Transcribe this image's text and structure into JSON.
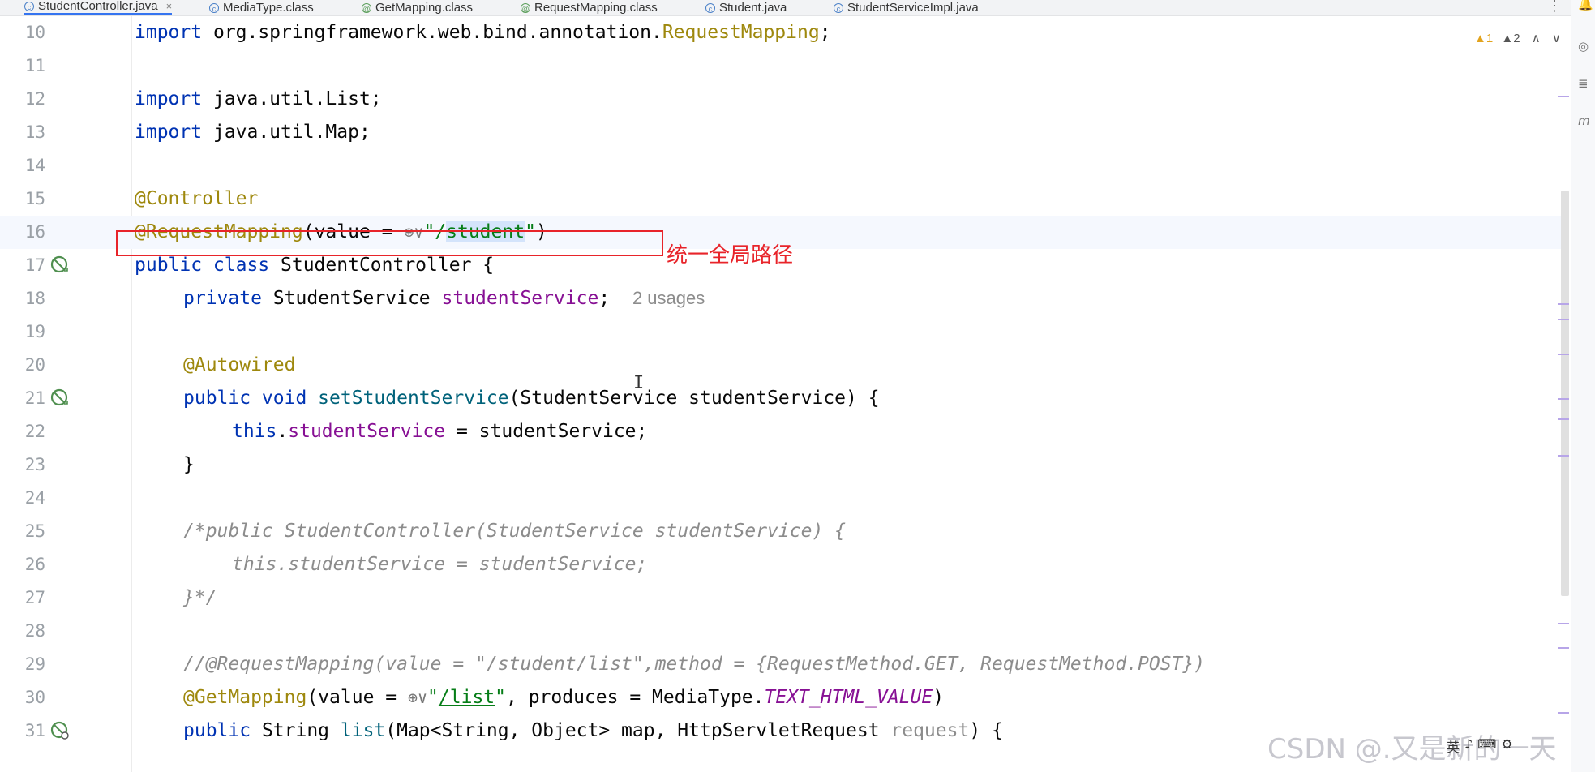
{
  "tabs": [
    {
      "label": "StudentController.java",
      "icon": "class-icon",
      "active": true
    },
    {
      "label": "MediaType.class",
      "icon": "class-icon"
    },
    {
      "label": "GetMapping.class",
      "icon": "annotation-icon"
    },
    {
      "label": "RequestMapping.class",
      "icon": "annotation-icon"
    },
    {
      "label": "Student.java",
      "icon": "class-icon"
    },
    {
      "label": "StudentServiceImpl.java",
      "icon": "class-icon"
    }
  ],
  "tab_close": "×",
  "tab_more": "⋮",
  "inspection": {
    "warnings": "▲1",
    "weak_warnings": "▲2",
    "up": "∧",
    "down": "∨"
  },
  "lines": {
    "10": "10",
    "11": "11",
    "12": "12",
    "13": "13",
    "14": "14",
    "15": "15",
    "16": "16",
    "17": "17",
    "18": "18",
    "19": "19",
    "20": "20",
    "21": "21",
    "22": "22",
    "23": "23",
    "24": "24",
    "25": "25",
    "26": "26",
    "27": "27",
    "28": "28",
    "29": "29",
    "30": "30",
    "31": "31"
  },
  "code": {
    "l10": {
      "kw": "import",
      "pkg": " org.springframework.web.bind.annotation.",
      "cls": "RequestMapping",
      "end": ";"
    },
    "l12": {
      "kw": "import",
      "rest": " java.util.List;"
    },
    "l13": {
      "kw": "import",
      "rest": " java.util.Map;"
    },
    "l15": {
      "ann": "@Controller"
    },
    "l16": {
      "ann": "@RequestMapping",
      "open": "(value = ",
      "globe": "⊕∨",
      "q1": "\"/",
      "sel": "student",
      "q2": "\"",
      "close": ")"
    },
    "l17": {
      "kw": "public class",
      "rest": " StudentController {"
    },
    "l18": {
      "kw": "private",
      "type": " StudentService ",
      "fld": "studentService",
      "end": ";",
      "hint": "2 usages"
    },
    "l20": {
      "ann": "@Autowired"
    },
    "l21": {
      "kw": "public void",
      "mth": " setStudentService",
      "rest": "(StudentService studentService) {"
    },
    "l22": {
      "kw": "this",
      "dot": ".",
      "fld": "studentService",
      "rest": " = studentService;"
    },
    "l23": {
      "rest": "}"
    },
    "l25": {
      "cmt": "/*public StudentController(StudentService studentService) {"
    },
    "l26": {
      "cmt": "this.studentService = studentService;"
    },
    "l27": {
      "cmt": "}*/"
    },
    "l29": {
      "cmt": "//@RequestMapping(value = \"/student/list\",method = {RequestMethod.GET, RequestMethod.POST})"
    },
    "l30": {
      "ann": "@GetMapping",
      "open": "(value = ",
      "globe": "⊕∨",
      "q1": "\"",
      "path": "/list",
      "q2": "\"",
      "mid": ", produces = MediaType.",
      "const": "TEXT_HTML_VALUE",
      "close": ")"
    },
    "l31": {
      "kw": "public",
      "type": " String ",
      "mth": "list",
      "rest": "(Map<String, Object> map, HttpServletRequest ",
      "param": "request",
      "end": ") {"
    }
  },
  "annotation_label": "统一全局路径",
  "cursor": "I",
  "watermark": "CSDN @.又是新的一天",
  "tray": [
    "英",
    "♪",
    "⌨",
    "⚙"
  ]
}
